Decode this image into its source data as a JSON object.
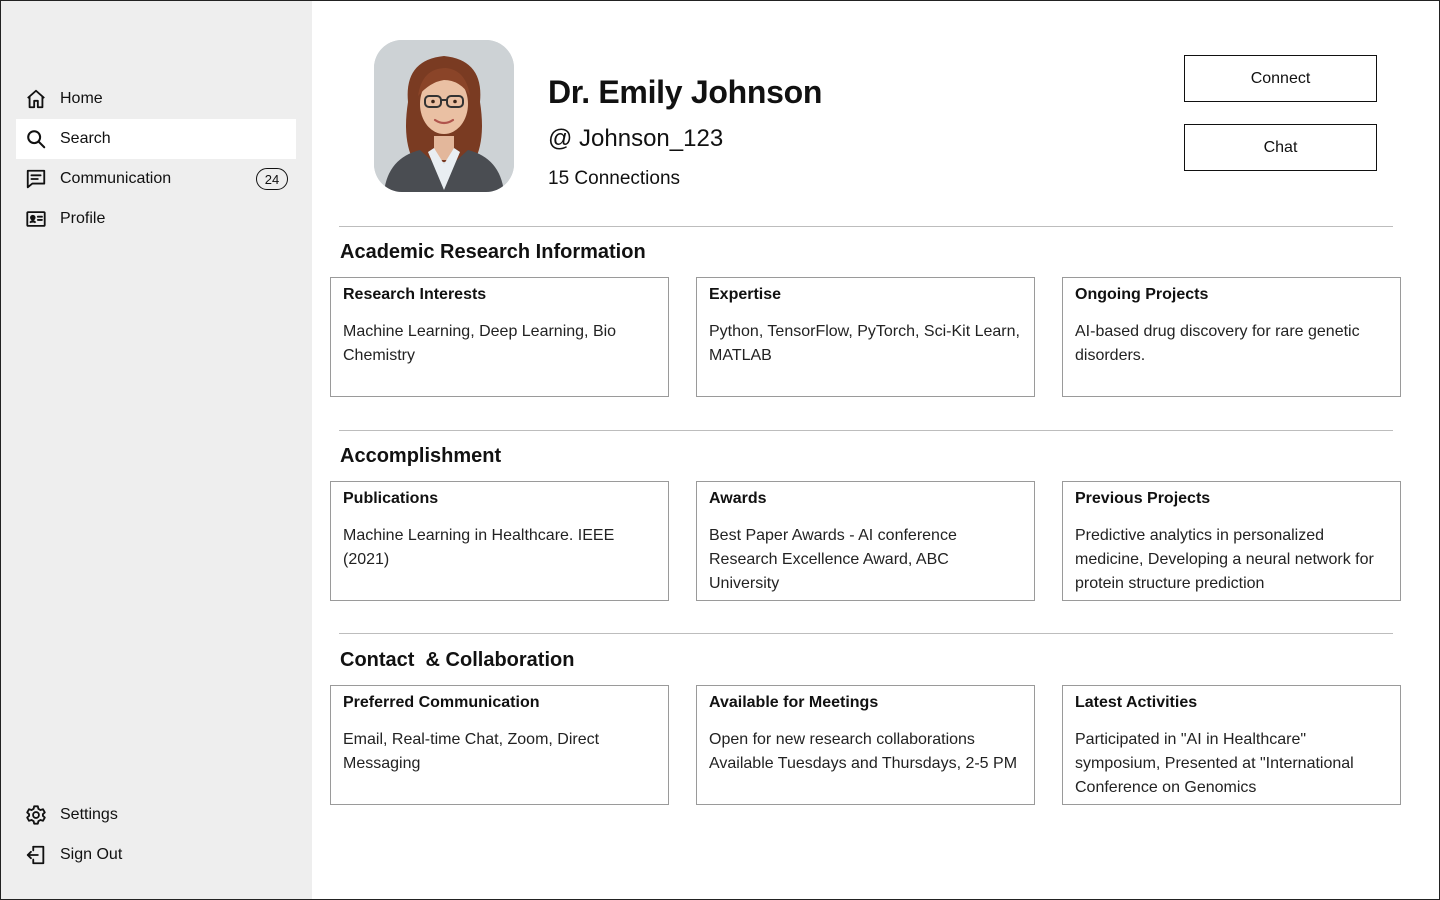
{
  "sidebar": {
    "items": [
      {
        "label": "Home",
        "icon": "home-icon"
      },
      {
        "label": "Search",
        "icon": "search-icon",
        "active": true
      },
      {
        "label": "Communication",
        "icon": "chat-icon",
        "badge": "24"
      },
      {
        "label": "Profile",
        "icon": "id-card-icon"
      }
    ],
    "bottom_items": [
      {
        "label": "Settings",
        "icon": "gear-icon"
      },
      {
        "label": "Sign Out",
        "icon": "sign-out-icon"
      }
    ]
  },
  "profile": {
    "name": "Dr. Emily Johnson",
    "handle": "@ Johnson_123",
    "connections": "15 Connections",
    "connect_label": "Connect",
    "chat_label": "Chat"
  },
  "sections": [
    {
      "title": "Academic Research Information",
      "cards": [
        {
          "title": "Research Interests",
          "lines": [
            "Machine Learning, Deep Learning, Bio Chemistry"
          ]
        },
        {
          "title": "Expertise",
          "lines": [
            "Python, TensorFlow, PyTorch, Sci-Kit Learn, MATLAB"
          ]
        },
        {
          "title": "Ongoing Projects",
          "lines": [
            "AI-based drug discovery for rare genetic disorders."
          ]
        }
      ]
    },
    {
      "title": "Accomplishment",
      "cards": [
        {
          "title": "Publications",
          "lines": [
            "Machine Learning in Healthcare. IEEE (2021)"
          ]
        },
        {
          "title": "Awards",
          "lines": [
            "Best Paper Awards - AI conference",
            "Research Excellence Award, ABC University"
          ]
        },
        {
          "title": "Previous Projects",
          "lines": [
            "Predictive analytics in personalized medicine, Developing a neural network for protein structure prediction"
          ]
        }
      ]
    },
    {
      "title": "Contact  & Collaboration",
      "cards": [
        {
          "title": "Preferred Communication",
          "lines": [
            "Email, Real-time Chat, Zoom, Direct Messaging"
          ]
        },
        {
          "title": "Available for Meetings",
          "lines": [
            "Open for new research collaborations",
            "Available Tuesdays and Thursdays, 2-5 PM"
          ]
        },
        {
          "title": "Latest Activities",
          "lines": [
            "Participated in \"AI in Healthcare\" symposium, Presented at \"International Conference on Genomics"
          ]
        }
      ]
    }
  ]
}
